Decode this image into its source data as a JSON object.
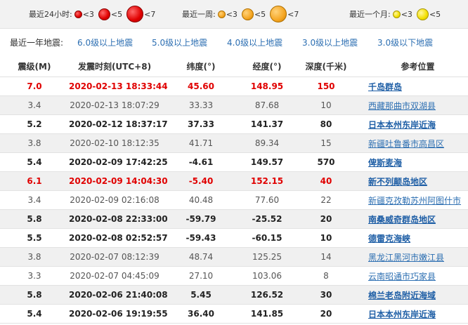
{
  "legend": [
    {
      "label": "最近24小时:",
      "color": "red",
      "items": [
        {
          "size": "s1",
          "text": "<3"
        },
        {
          "size": "s2",
          "text": "<5"
        },
        {
          "size": "s3",
          "text": "<7"
        }
      ]
    },
    {
      "label": "最近一周:",
      "color": "orange",
      "items": [
        {
          "size": "s1",
          "text": "<3"
        },
        {
          "size": "s2",
          "text": "<5"
        },
        {
          "size": "s3",
          "text": "<7"
        }
      ]
    },
    {
      "label": "最近一个月:",
      "color": "yellow",
      "items": [
        {
          "size": "s1",
          "text": "<3"
        },
        {
          "size": "s2",
          "text": "<5"
        }
      ]
    }
  ],
  "year_filter": {
    "label": "最近一年地震:",
    "links": [
      "6.0级以上地震",
      "5.0级以上地震",
      "4.0级以上地震",
      "3.0级以上地震",
      "3.0级以下地震"
    ]
  },
  "table": {
    "headers": [
      "震级(M)",
      "发震时刻(UTC+8)",
      "纬度(°)",
      "经度(°)",
      "深度(千米)",
      "参考位置"
    ],
    "rows": [
      {
        "style": "big",
        "mag": "7.0",
        "time": "2020-02-13 18:33:44",
        "lat": "45.60",
        "lon": "148.95",
        "depth": "150",
        "location": "千岛群岛"
      },
      {
        "style": "normal",
        "mag": "3.4",
        "time": "2020-02-13 18:07:29",
        "lat": "33.33",
        "lon": "87.68",
        "depth": "10",
        "location": "西藏那曲市双湖县"
      },
      {
        "style": "bold",
        "mag": "5.2",
        "time": "2020-02-12 18:37:17",
        "lat": "37.33",
        "lon": "141.37",
        "depth": "80",
        "location": "日本本州东岸近海"
      },
      {
        "style": "normal",
        "mag": "3.8",
        "time": "2020-02-10 18:12:35",
        "lat": "41.71",
        "lon": "89.34",
        "depth": "15",
        "location": "新疆吐鲁番市高昌区"
      },
      {
        "style": "bold",
        "mag": "5.4",
        "time": "2020-02-09 17:42:25",
        "lat": "-4.61",
        "lon": "149.57",
        "depth": "570",
        "location": "俾斯麦海"
      },
      {
        "style": "big",
        "mag": "6.1",
        "time": "2020-02-09 14:04:30",
        "lat": "-5.40",
        "lon": "152.15",
        "depth": "40",
        "location": "新不列颠岛地区"
      },
      {
        "style": "normal",
        "mag": "3.4",
        "time": "2020-02-09 02:16:08",
        "lat": "40.48",
        "lon": "77.60",
        "depth": "22",
        "location": "新疆克孜勒苏州阿图什市"
      },
      {
        "style": "bold",
        "mag": "5.8",
        "time": "2020-02-08 22:33:00",
        "lat": "-59.79",
        "lon": "-25.52",
        "depth": "20",
        "location": "南桑威奇群岛地区"
      },
      {
        "style": "bold",
        "mag": "5.5",
        "time": "2020-02-08 02:52:57",
        "lat": "-59.43",
        "lon": "-60.15",
        "depth": "10",
        "location": "德雷克海峡"
      },
      {
        "style": "normal",
        "mag": "3.8",
        "time": "2020-02-07 08:12:39",
        "lat": "48.74",
        "lon": "125.25",
        "depth": "14",
        "location": "黑龙江黑河市嫩江县"
      },
      {
        "style": "normal",
        "mag": "3.3",
        "time": "2020-02-07 04:45:09",
        "lat": "27.10",
        "lon": "103.06",
        "depth": "8",
        "location": "云南昭通市巧家县"
      },
      {
        "style": "bold",
        "mag": "5.8",
        "time": "2020-02-06 21:40:08",
        "lat": "5.45",
        "lon": "126.52",
        "depth": "30",
        "location": "棉兰老岛附近海域"
      },
      {
        "style": "bold",
        "mag": "5.4",
        "time": "2020-02-06 19:19:55",
        "lat": "36.40",
        "lon": "141.85",
        "depth": "20",
        "location": "日本本州东岸近海"
      }
    ]
  },
  "colors": {
    "link": "#2d6fb2",
    "major_quake": "#e00000",
    "alt_row": "#f0f0f0"
  }
}
